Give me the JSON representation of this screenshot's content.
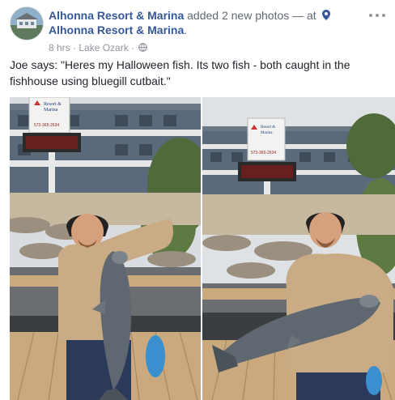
{
  "post": {
    "page_name": "Alhonna Resort & Marina",
    "action_text": " added 2 new photos — at ",
    "location": "Alhonna Resort & Marina",
    "location_suffix": ".",
    "time": "8 hrs",
    "separator": " · ",
    "place": "Lake Ozark",
    "meta_separator": " · ",
    "privacy_icon": "globe-icon",
    "more_icon": "more-options-icon",
    "body": "Joe says: \"Heres my Halloween fish. Its two fish - both caught in the fishhouse using bluegill cutbait.\""
  },
  "photos": {
    "sign_line1": "Resort &",
    "sign_line2": "Marina",
    "sign_phone": "573-365-2634"
  },
  "colors": {
    "link": "#365899",
    "meta": "#90949c",
    "text": "#1d2129",
    "sky": "#d9dce0",
    "building": "#5b6a7a",
    "dock": "#c9a97d",
    "jacket": "#c9ab86"
  }
}
